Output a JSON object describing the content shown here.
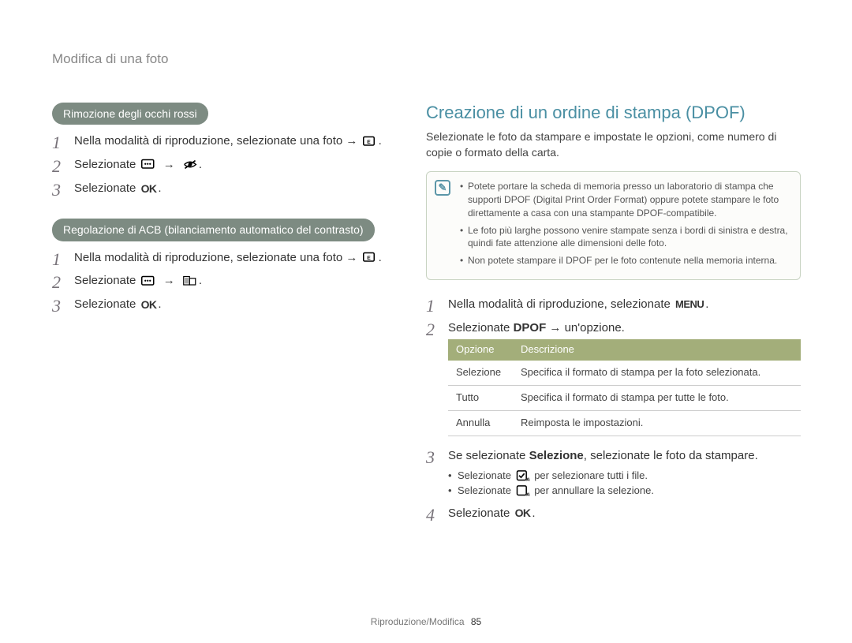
{
  "breadcrumb": "Modifica di una foto",
  "left": {
    "pill1": "Rimozione degli occhi rossi",
    "steps1": {
      "s1_a": "Nella modalità di riproduzione, selezionate una foto →",
      "s1_b": ".",
      "s2_a": "Selezionate",
      "s2_b": "→",
      "s2_c": ".",
      "s3_a": "Selezionate",
      "s3_b": "."
    },
    "pill2": "Regolazione di ACB (bilanciamento automatico del contrasto)",
    "steps2": {
      "s1_a": "Nella modalità di riproduzione, selezionate una foto →",
      "s1_b": ".",
      "s2_a": "Selezionate",
      "s2_b": "→",
      "s2_c": ".",
      "s3_a": "Selezionate",
      "s3_b": "."
    }
  },
  "right": {
    "title": "Creazione di un ordine di stampa (DPOF)",
    "intro": "Selezionate le foto da stampare e impostate le opzioni, come numero di copie o formato della carta.",
    "notes": [
      "Potete portare la scheda di memoria presso un laboratorio di stampa che supporti DPOF (Digital Print Order Format) oppure potete stampare le foto direttamente a casa con una stampante DPOF-compatibile.",
      "Le foto più larghe possono venire stampate senza i bordi di sinistra e destra, quindi fate attenzione alle dimensioni delle foto.",
      "Non potete stampare il DPOF per le foto contenute nella memoria interna."
    ],
    "steps": {
      "s1_a": "Nella modalità di riproduzione, selezionate",
      "s1_b": ".",
      "s2_a": "Selezionate ",
      "s2_bold": "DPOF",
      "s2_b": " → un'opzione.",
      "s3": "Se selezionate Selezione, selezionate le foto da stampare.",
      "s3_word_bold": "Selezione",
      "s3_prefix": "Se selezionate ",
      "s3_suffix": ", selezionate le foto da stampare.",
      "s3_bullets": [
        {
          "pre": "Selezionate ",
          "post": " per selezionare tutti i file."
        },
        {
          "pre": "Selezionate ",
          "post": " per annullare la selezione."
        }
      ],
      "s4_a": "Selezionate",
      "s4_b": "."
    },
    "table": {
      "head_opt": "Opzione",
      "head_desc": "Descrizione",
      "rows": [
        {
          "opt": "Selezione",
          "desc": "Specifica il formato di stampa per la foto selezionata."
        },
        {
          "opt": "Tutto",
          "desc": "Specifica il formato di stampa per tutte le foto."
        },
        {
          "opt": "Annulla",
          "desc": "Reimposta le impostazioni."
        }
      ]
    }
  },
  "glyphs": {
    "ok": "OK",
    "menu": "MENU"
  },
  "footer": {
    "section": "Riproduzione/Modifica",
    "page": "85"
  }
}
